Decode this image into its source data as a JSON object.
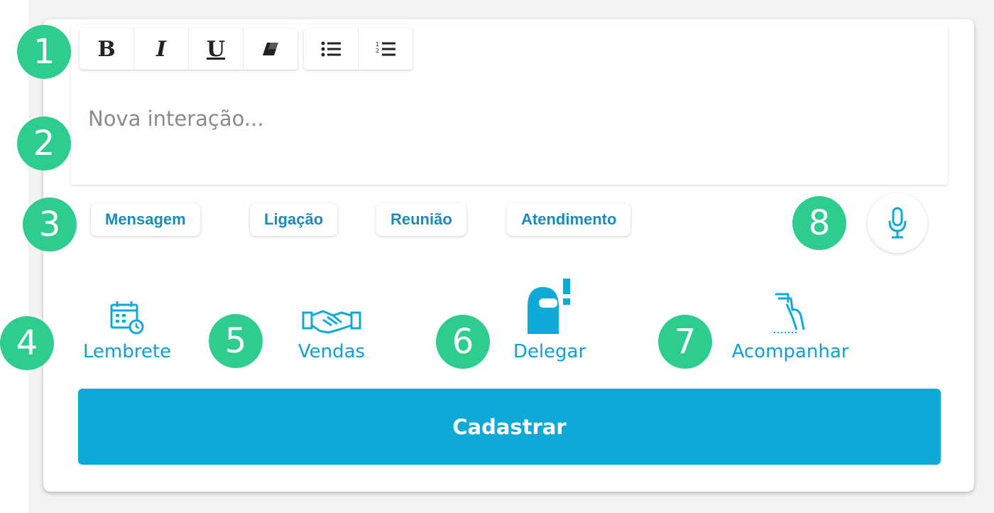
{
  "toolbar": {
    "bold": "B",
    "italic": "I",
    "underline": "U"
  },
  "editor": {
    "placeholder": "Nova interação..."
  },
  "chips": [
    "Mensagem",
    "Ligação",
    "Reunião",
    "Atendimento"
  ],
  "actions": {
    "lembrete": "Lembrete",
    "vendas": "Vendas",
    "delegar": "Delegar",
    "acompanhar": "Acompanhar"
  },
  "submit_label": "Cadastrar",
  "badges": [
    "1",
    "2",
    "3",
    "4",
    "5",
    "6",
    "7",
    "8"
  ],
  "colors": {
    "accent": "#0fa9d8",
    "chip_text": "#1e8ab8",
    "badge": "#2fcc90"
  },
  "icons": [
    "eraser-icon",
    "bullet-list-icon",
    "numbered-list-icon",
    "microphone-icon",
    "calendar-clock-icon",
    "handshake-icon",
    "delegate-icon",
    "follow-hand-icon"
  ]
}
